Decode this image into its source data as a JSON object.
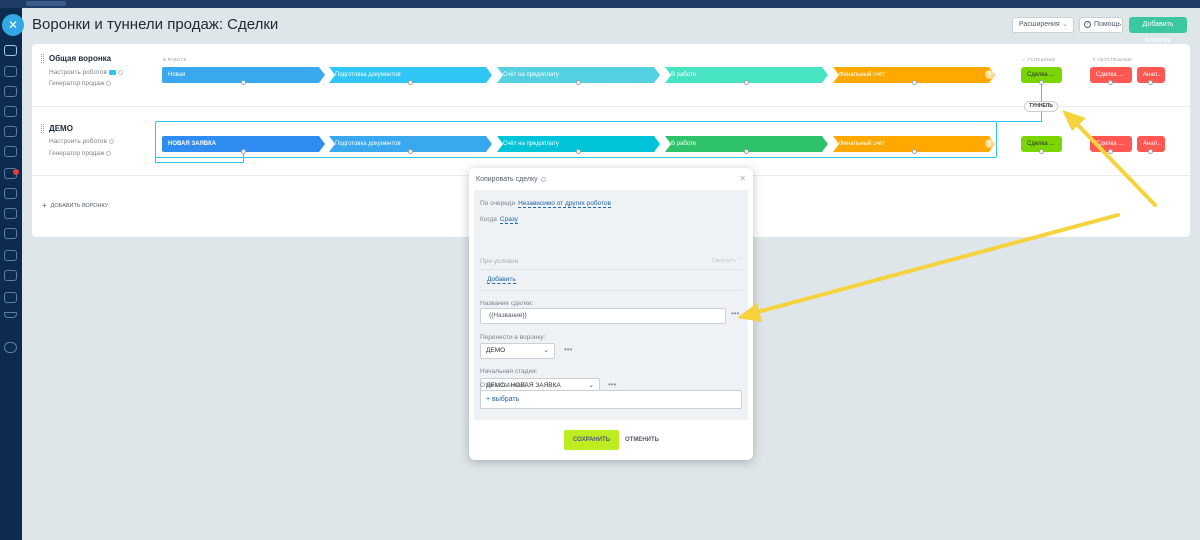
{
  "page": {
    "title": "Воронки и туннели продаж: Сделки"
  },
  "header": {
    "extensions_label": "Расширения",
    "help_label": "Помощь",
    "add_funnel_label": "Добавить воронку"
  },
  "groups": {
    "in_work": "В работе",
    "success": "Успешные",
    "fail": "Неуспешные"
  },
  "funnels": [
    {
      "name": "Общая воронка",
      "robots_link": "Настроить роботов",
      "generator_link": "Генератор продаж",
      "stages": [
        {
          "label": "Новая",
          "color": "#39a8ef"
        },
        {
          "label": "Подготовка документов",
          "color": "#2fc6f6"
        },
        {
          "label": "Счёт на предоплату",
          "color": "#55d0e0"
        },
        {
          "label": "В работе",
          "color": "#47e4c2"
        },
        {
          "label": "Финальный счёт",
          "color": "#ffa900"
        }
      ],
      "success_stage": {
        "label": "Сделка ...",
        "color": "#7bd500"
      },
      "fail_stages": [
        {
          "label": "Сделка ...",
          "color": "#ff5752"
        },
        {
          "label": "Анал...",
          "color": "#ff5752"
        }
      ]
    },
    {
      "name": "ДЕМО",
      "robots_link": "Настроить роботов",
      "generator_link": "Генератор продаж",
      "stages": [
        {
          "label": "НОВАЯ ЗАЯВКА",
          "color": "#2f8cf0"
        },
        {
          "label": "Подготовка документов",
          "color": "#39a8ef"
        },
        {
          "label": "Счёт на предоплату",
          "color": "#00c4d8"
        },
        {
          "label": "В работе",
          "color": "#2ec26a"
        },
        {
          "label": "Финальный счёт",
          "color": "#ffa900"
        }
      ],
      "success_stage": {
        "label": "Сделка ...",
        "color": "#7bd500"
      },
      "fail_stages": [
        {
          "label": "Сделка ...",
          "color": "#ff5752"
        },
        {
          "label": "Анал...",
          "color": "#ff5752"
        }
      ]
    }
  ],
  "tunnel_badge": "ТУННЕЛЬ",
  "add_funnel_link": "ДОБАВИТЬ ВОРОНКУ",
  "dialog": {
    "title": "Копировать сделку",
    "order_label": "По очереди",
    "order_value": "Независимо от других роботов",
    "when_label": "Когда",
    "when_value": "Сразу",
    "condition_label": "При условии",
    "collapse_label": "Свернуть",
    "add_label": "Добавить",
    "deal_name_label": "Название сделки:",
    "deal_name_value": "{{Название}}",
    "move_funnel_label": "Перенести в воронку:",
    "move_funnel_value": "ДЕМО",
    "start_stage_label": "Начальная стадия:",
    "start_stage_value": "ДЕМО / НОВАЯ ЗАЯВКА",
    "responsible_label": "Ответственный:",
    "responsible_value": "+ выбрать",
    "save_label": "СОХРАНИТЬ",
    "cancel_label": "ОТМЕНИТЬ"
  },
  "colors": {
    "accent_green": "#bbed21",
    "link_blue": "#2067b0",
    "tunnel_blue": "#2fc6f6",
    "arrow_yellow": "#f6d33c",
    "sidebar_bg": "#0d2a4f"
  }
}
